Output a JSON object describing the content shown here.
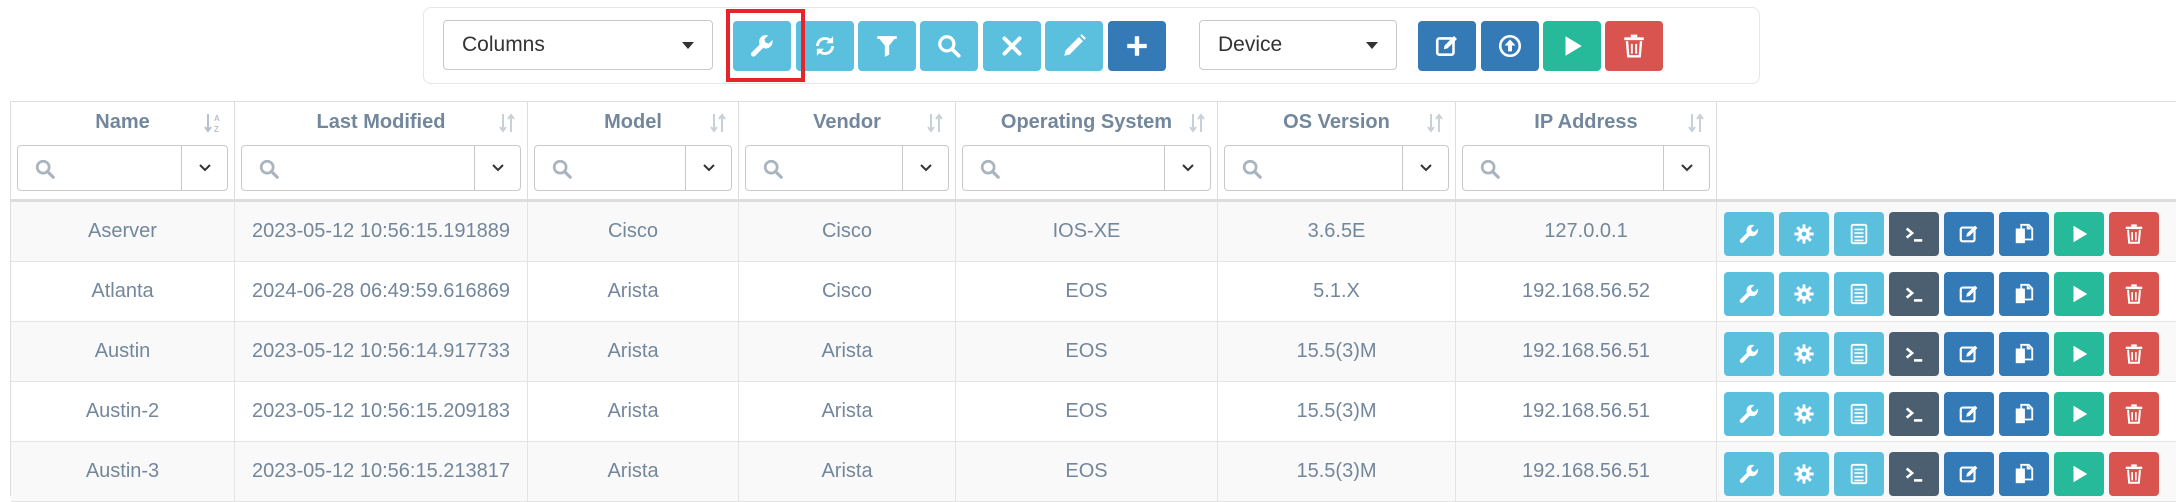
{
  "toolbar": {
    "columns_select": "Columns",
    "model_select": "Device",
    "buttons": [
      {
        "name": "advanced-search-button",
        "icon": "wrench-icon",
        "color": "#5bc0de"
      },
      {
        "name": "refresh-button",
        "icon": "refresh-icon",
        "color": "#5bc0de"
      },
      {
        "name": "filter-button",
        "icon": "filter-icon",
        "color": "#5bc0de"
      },
      {
        "name": "search-button",
        "icon": "search-icon",
        "color": "#5bc0de"
      },
      {
        "name": "clear-search-button",
        "icon": "close-icon",
        "color": "#5bc0de"
      },
      {
        "name": "edit-button",
        "icon": "pencil-icon",
        "color": "#5bc0de"
      },
      {
        "name": "add-button",
        "icon": "plus-icon",
        "color": "#337ab7"
      },
      {
        "name": "bulk-edit-button",
        "icon": "edit-square-icon",
        "color": "#337ab7"
      },
      {
        "name": "export-button",
        "icon": "upload-circle-icon",
        "color": "#337ab7"
      },
      {
        "name": "run-button",
        "icon": "play-icon",
        "color": "#26b99a"
      },
      {
        "name": "bulk-delete-button",
        "icon": "trash-icon",
        "color": "#d9534f"
      }
    ]
  },
  "columns": [
    "Name",
    "Last Modified",
    "Model",
    "Vendor",
    "Operating System",
    "OS Version",
    "IP Address"
  ],
  "rows": [
    {
      "name": "Aserver",
      "last_modified": "2023-05-12 10:56:15.191889",
      "model": "Cisco",
      "vendor": "Cisco",
      "os": "IOS-XE",
      "os_version": "3.6.5E",
      "ip": "127.0.0.1"
    },
    {
      "name": "Atlanta",
      "last_modified": "2024-06-28 06:49:59.616869",
      "model": "Arista",
      "vendor": "Cisco",
      "os": "EOS",
      "os_version": "5.1.X",
      "ip": "192.168.56.52"
    },
    {
      "name": "Austin",
      "last_modified": "2023-05-12 10:56:14.917733",
      "model": "Arista",
      "vendor": "Arista",
      "os": "EOS",
      "os_version": "15.5(3)M",
      "ip": "192.168.56.51"
    },
    {
      "name": "Austin-2",
      "last_modified": "2023-05-12 10:56:15.209183",
      "model": "Arista",
      "vendor": "Arista",
      "os": "EOS",
      "os_version": "15.5(3)M",
      "ip": "192.168.56.51"
    },
    {
      "name": "Austin-3",
      "last_modified": "2023-05-12 10:56:15.213817",
      "model": "Arista",
      "vendor": "Arista",
      "os": "EOS",
      "os_version": "15.5(3)M",
      "ip": "192.168.56.51"
    }
  ],
  "row_actions": [
    {
      "name": "device-settings-button",
      "icon": "wrench-icon",
      "color": "#5bc0de"
    },
    {
      "name": "properties-button",
      "icon": "gear-icon",
      "color": "#5bc0de"
    },
    {
      "name": "results-button",
      "icon": "list-icon",
      "color": "#5bc0de"
    },
    {
      "name": "terminal-button",
      "icon": "terminal-icon",
      "color": "#4b5f71"
    },
    {
      "name": "edit-row-button",
      "icon": "edit-square-icon",
      "color": "#337ab7"
    },
    {
      "name": "duplicate-button",
      "icon": "copy-icon",
      "color": "#337ab7"
    },
    {
      "name": "run-row-button",
      "icon": "play-icon",
      "color": "#26b99a"
    },
    {
      "name": "delete-row-button",
      "icon": "trash-icon",
      "color": "#d9534f"
    }
  ]
}
